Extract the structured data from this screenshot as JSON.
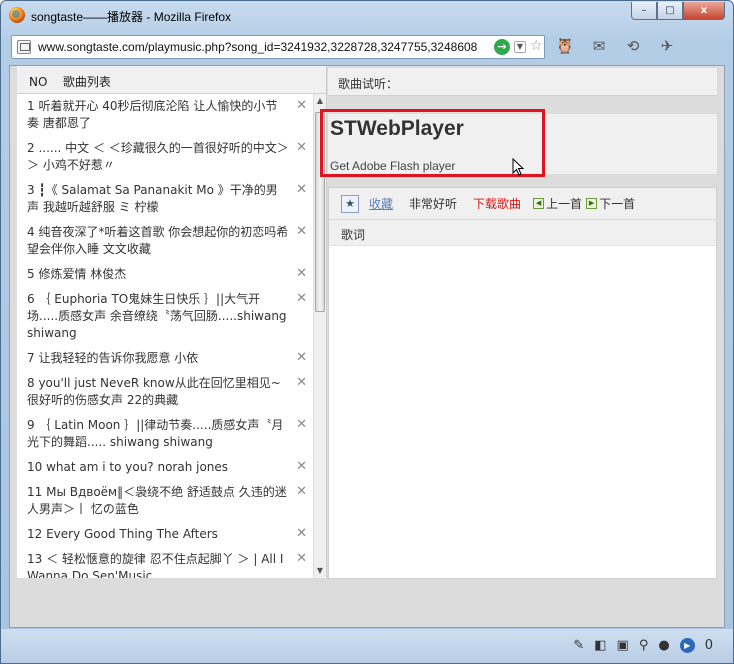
{
  "window": {
    "title": "songtaste——播放器 - Mozilla Firefox",
    "minimize_label": "–",
    "maximize_label": "□",
    "close_label": "x"
  },
  "address_bar": {
    "url": "www.songtaste.com/playmusic.php?song_id=3241932,3228728,3247755,3248608,3248",
    "go_label": "→",
    "dropdown_label": "▼",
    "star_label": "☆"
  },
  "nav_icons": [
    "🦉",
    "✉",
    "⟲",
    "✈"
  ],
  "playlist": {
    "header_no": "NO",
    "header_title": "歌曲列表",
    "delete_label": "✕",
    "items": [
      "1 听着就开心 40秒后彻底沦陷 让人愉快的小节奏 唐都恩了",
      "2 ...... 中文 ＜ ＜珍藏很久的一首很好听的中文＞＞ 小鸡不好惹〃",
      "3 ┇《 Salamat Sa Pananakit Mo 》干净的男声 我越听越舒服 ミ 柠檬",
      "4 纯音夜深了*听着这首歌 你会想起你的初恋吗希望会伴你入睡 文文收藏",
      "5 修炼爱情 林俊杰",
      "6 ｛ Euphoria TO鬼妹生日快乐 ｝||大气开场.....质感女声 余音缭绕〝荡气回肠.....shiwang shiwang",
      "7 让我轻轻的告诉你我愿意 小依",
      "8 you'll just NeveR know从此在回忆里相见~很好听的伤感女声 22的典藏",
      "9 ｛ Latin Moon ｝||律动节奏.....质感女声〝月光下的舞蹈..... shiwang shiwang",
      "10 what am i to you? norah jones",
      "11 Мы Вдвоём‖＜袅绕不绝 舒适鼓点 久违的迷人男声＞丨 忆の蓝色",
      "12 Every Good Thing The Afters",
      "13 ＜ 轻松惬意的旋律 忍不住点起脚丫 ＞ | All I Wanna Do Sen'Music"
    ]
  },
  "right_panel": {
    "trial_label": "歌曲试听：",
    "player_title": "STWebPlayer",
    "player_sub": "Get Adobe Flash player",
    "toolbar": {
      "star_icon": "★",
      "favorite": "收藏",
      "nice": "非常好听",
      "download": "下载歌曲",
      "prev": "上一首",
      "next": "下一首"
    },
    "lyrics_label": "歌词"
  },
  "statusbar": {
    "count": "0"
  },
  "colors": {
    "highlight": "#e0141e",
    "download": "#d61a1a",
    "favorite": "#5f7fb6"
  }
}
